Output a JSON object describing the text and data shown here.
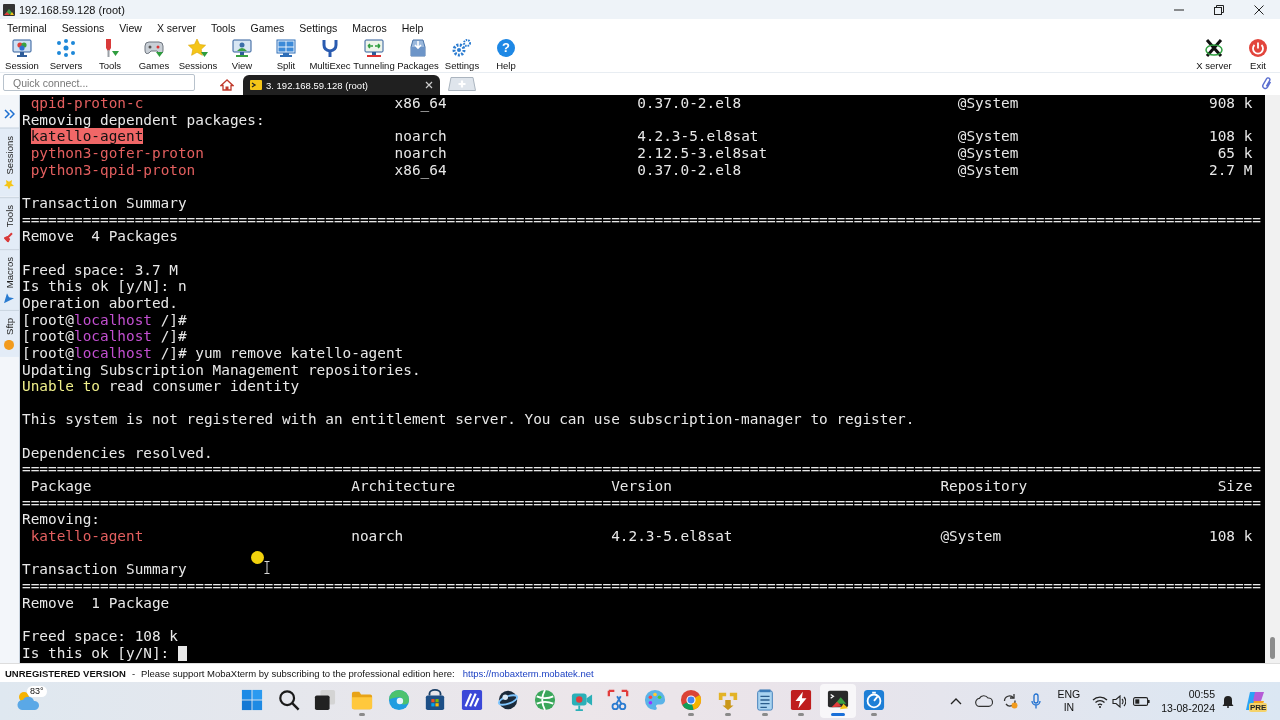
{
  "window": {
    "title": "192.168.59.128 (root)"
  },
  "menu_bar": [
    "Terminal",
    "Sessions",
    "View",
    "X server",
    "Tools",
    "Games",
    "Settings",
    "Macros",
    "Help"
  ],
  "toolbar": {
    "left": [
      {
        "label": "Session"
      },
      {
        "label": "Servers"
      },
      {
        "label": "Tools"
      },
      {
        "label": "Games"
      },
      {
        "label": "Sessions"
      },
      {
        "label": "View"
      },
      {
        "label": "Split"
      },
      {
        "label": "MultiExec"
      },
      {
        "label": "Tunneling"
      },
      {
        "label": "Packages"
      },
      {
        "label": "Settings"
      },
      {
        "label": "Help",
        "glyph": "?"
      }
    ],
    "right": [
      {
        "label": "X server"
      },
      {
        "label": "Exit"
      }
    ]
  },
  "quick_connect": {
    "placeholder": "Quick connect..."
  },
  "session_tabs": [
    {
      "kind": "home",
      "selected": false
    },
    {
      "kind": "session",
      "label": "3. 192.168.59.128 (root)",
      "selected": true
    }
  ],
  "sidebar": {
    "tabs": [
      {
        "label": "Sessions",
        "selected": false
      },
      {
        "label": "Tools",
        "selected": false
      },
      {
        "label": "Macros",
        "selected": false
      },
      {
        "label": "Sftp",
        "selected": false
      }
    ]
  },
  "terminal": {
    "cursor_visible": true,
    "lines": [
      {
        "kind": "text",
        "segments": [
          {
            "kind": "package",
            "text": " qpid-proton-c"
          },
          {
            "kind": "plain",
            "text": "                             x86_64"
          },
          {
            "kind": "plain",
            "text": "                      0.37.0-2.el8"
          },
          {
            "kind": "plain",
            "text": "                         @System"
          },
          {
            "kind": "plain",
            "text": "                      908 k"
          }
        ]
      },
      {
        "kind": "text",
        "segments": [
          {
            "kind": "plain",
            "text": "Removing dependent packages:"
          }
        ]
      },
      {
        "kind": "text",
        "segments": [
          {
            "kind": "highlight",
            "text": " katello-agent"
          },
          {
            "kind": "plain",
            "text": "                             noarch"
          },
          {
            "kind": "plain",
            "text": "                      4.2.3-5.el8sat"
          },
          {
            "kind": "plain",
            "text": "                       @System"
          },
          {
            "kind": "plain",
            "text": "                      108 k"
          }
        ]
      },
      {
        "kind": "text",
        "segments": [
          {
            "kind": "package",
            "text": " python3-gofer-proton"
          },
          {
            "kind": "plain",
            "text": "                      noarch"
          },
          {
            "kind": "plain",
            "text": "                      2.12.5-3.el8sat"
          },
          {
            "kind": "plain",
            "text": "                      @System"
          },
          {
            "kind": "plain",
            "text": "                       65 k"
          }
        ]
      },
      {
        "kind": "text",
        "segments": [
          {
            "kind": "package",
            "text": " python3-qpid-proton"
          },
          {
            "kind": "plain",
            "text": "                       x86_64"
          },
          {
            "kind": "plain",
            "text": "                      0.37.0-2.el8"
          },
          {
            "kind": "plain",
            "text": "                         @System"
          },
          {
            "kind": "plain",
            "text": "                      2.7 M"
          }
        ]
      },
      {
        "kind": "blank"
      },
      {
        "kind": "text",
        "segments": [
          {
            "kind": "plain",
            "text": "Transaction Summary"
          }
        ]
      },
      {
        "kind": "text",
        "segments": [
          {
            "kind": "rule",
            "text": "==============================================================================================================================================="
          }
        ]
      },
      {
        "kind": "text",
        "segments": [
          {
            "kind": "plain",
            "text": "Remove  4 Packages"
          }
        ]
      },
      {
        "kind": "blank"
      },
      {
        "kind": "text",
        "segments": [
          {
            "kind": "plain",
            "text": "Freed space: 3.7 M"
          }
        ]
      },
      {
        "kind": "text",
        "segments": [
          {
            "kind": "plain",
            "text": "Is this ok [y/N]: n"
          }
        ]
      },
      {
        "kind": "text",
        "segments": [
          {
            "kind": "plain",
            "text": "Operation aborted."
          }
        ]
      },
      {
        "kind": "text",
        "segments": [
          {
            "kind": "plain",
            "text": "[root@"
          },
          {
            "kind": "host",
            "text": "localhost"
          },
          {
            "kind": "plain",
            "text": " /]#"
          }
        ]
      },
      {
        "kind": "text",
        "segments": [
          {
            "kind": "plain",
            "text": "[root@"
          },
          {
            "kind": "host",
            "text": "localhost"
          },
          {
            "kind": "plain",
            "text": " /]#"
          }
        ]
      },
      {
        "kind": "text",
        "segments": [
          {
            "kind": "plain",
            "text": "[root@"
          },
          {
            "kind": "host",
            "text": "localhost"
          },
          {
            "kind": "plain",
            "text": " /]# yum remove katello-agent"
          }
        ]
      },
      {
        "kind": "text",
        "segments": [
          {
            "kind": "plain",
            "text": "Updating Subscription Management repositories."
          }
        ]
      },
      {
        "kind": "text",
        "segments": [
          {
            "kind": "warning",
            "text": "Unable to"
          },
          {
            "kind": "plain",
            "text": " read consumer identity"
          }
        ]
      },
      {
        "kind": "blank"
      },
      {
        "kind": "text",
        "segments": [
          {
            "kind": "plain",
            "text": "This system is not registered with an entitlement server. You can use subscription-manager to register."
          }
        ]
      },
      {
        "kind": "blank"
      },
      {
        "kind": "text",
        "segments": [
          {
            "kind": "plain",
            "text": "Dependencies resolved."
          }
        ]
      },
      {
        "kind": "text",
        "segments": [
          {
            "kind": "rule",
            "text": "==============================================================================================================================================="
          }
        ]
      },
      {
        "kind": "text",
        "segments": [
          {
            "kind": "plain",
            "text": " Package"
          },
          {
            "kind": "plain",
            "text": "                              Architecture"
          },
          {
            "kind": "plain",
            "text": "                  Version"
          },
          {
            "kind": "plain",
            "text": "                               Repository"
          },
          {
            "kind": "plain",
            "text": "                      Size"
          }
        ]
      },
      {
        "kind": "text",
        "segments": [
          {
            "kind": "rule",
            "text": "==============================================================================================================================================="
          }
        ]
      },
      {
        "kind": "text",
        "segments": [
          {
            "kind": "plain",
            "text": "Removing:"
          }
        ]
      },
      {
        "kind": "text",
        "segments": [
          {
            "kind": "package",
            "text": " katello-agent"
          },
          {
            "kind": "plain",
            "text": "                        noarch"
          },
          {
            "kind": "plain",
            "text": "                        4.2.3-5.el8sat"
          },
          {
            "kind": "plain",
            "text": "                        @System"
          },
          {
            "kind": "plain",
            "text": "                        108 k"
          }
        ]
      },
      {
        "kind": "blank"
      },
      {
        "kind": "text",
        "segments": [
          {
            "kind": "plain",
            "text": "Transaction Summary"
          }
        ]
      },
      {
        "kind": "text",
        "segments": [
          {
            "kind": "rule",
            "text": "==============================================================================================================================================="
          }
        ]
      },
      {
        "kind": "text",
        "segments": [
          {
            "kind": "plain",
            "text": "Remove  1 Package"
          }
        ]
      },
      {
        "kind": "blank"
      },
      {
        "kind": "text",
        "segments": [
          {
            "kind": "plain",
            "text": "Freed space: 108 k"
          }
        ]
      },
      {
        "kind": "text",
        "segments": [
          {
            "kind": "plain",
            "text": "Is this ok [y/N]: "
          }
        ]
      }
    ]
  },
  "status_bar": {
    "edition": "UNREGISTERED VERSION",
    "separator": "-",
    "message": "Please support MobaXterm by subscribing to the professional edition here:",
    "link": "https://mobaxterm.mobatek.net"
  },
  "taskbar": {
    "temperature": "83°",
    "items": [
      {
        "running": false,
        "active": false
      },
      {
        "running": false,
        "active": false
      },
      {
        "running": false,
        "active": false
      },
      {
        "running": true,
        "active": false
      },
      {
        "running": false,
        "active": false
      },
      {
        "running": false,
        "active": false
      },
      {
        "running": false,
        "active": false
      },
      {
        "running": false,
        "active": false
      },
      {
        "running": false,
        "active": false
      },
      {
        "running": false,
        "active": false
      },
      {
        "running": false,
        "active": false
      },
      {
        "running": false,
        "active": false
      },
      {
        "running": true,
        "active": false
      },
      {
        "running": true,
        "active": false
      },
      {
        "running": true,
        "active": false
      },
      {
        "running": true,
        "active": false
      },
      {
        "running": true,
        "active": true
      },
      {
        "running": true,
        "active": false
      }
    ],
    "tray": {
      "language": "ENG",
      "region": "IN",
      "time": "00:55",
      "date": "13-08-2024",
      "badge": "PRE"
    }
  }
}
